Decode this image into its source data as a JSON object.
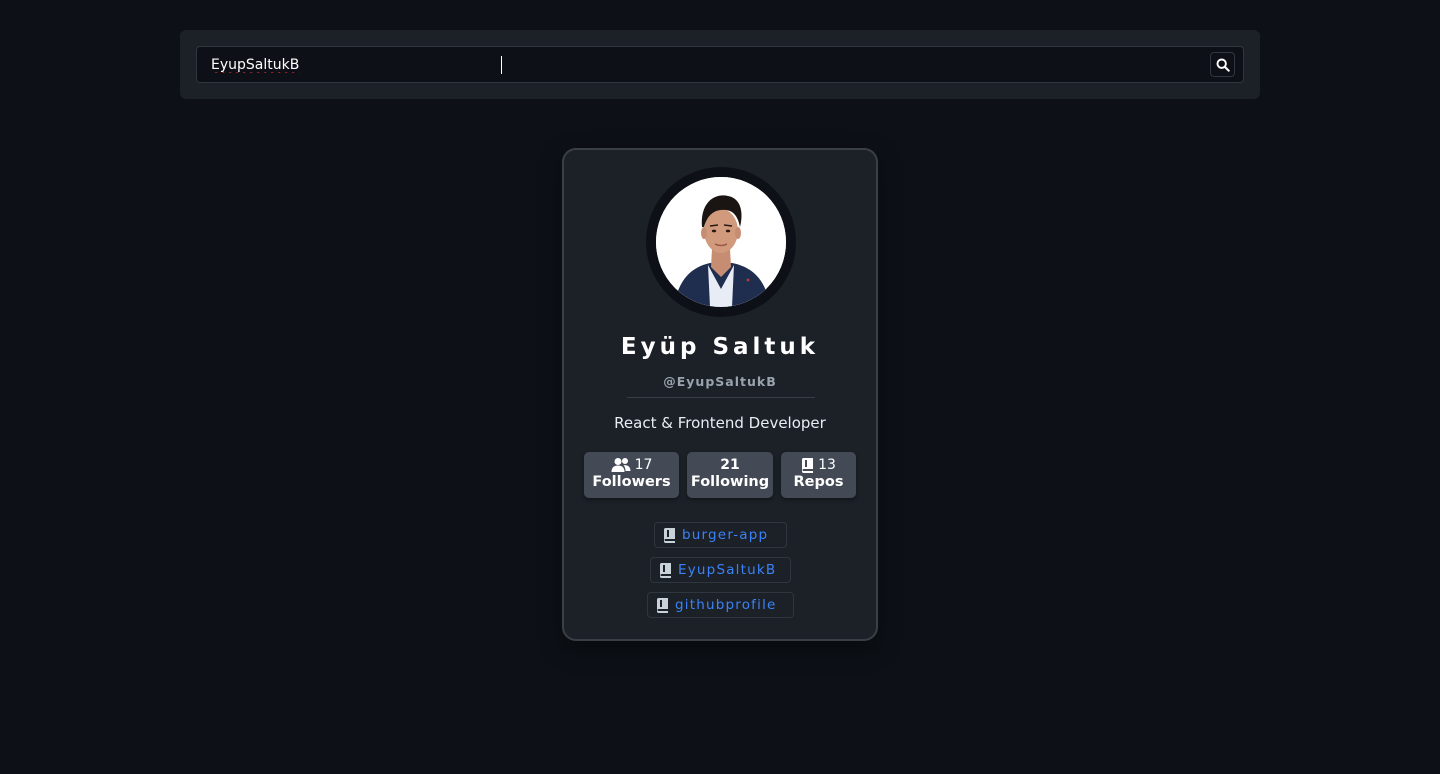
{
  "search": {
    "value": "EyupSaltukB",
    "icon": "search-icon"
  },
  "profile": {
    "name": "Eyüp Saltuk",
    "login": "@EyupSaltukB",
    "bio": "React & Frontend Developer",
    "avatar_icon": "avatar"
  },
  "stats": {
    "followers": {
      "count": "17",
      "label": "Followers",
      "icon": "users-icon"
    },
    "following": {
      "count": "21",
      "label": "Following"
    },
    "repos": {
      "count": "13",
      "label": "Repos",
      "icon": "book-icon"
    }
  },
  "repos": [
    {
      "name": "burger-app",
      "icon": "book-icon"
    },
    {
      "name": "EyupSaltukB",
      "icon": "book-icon"
    },
    {
      "name": "githubprofile",
      "icon": "book-icon"
    }
  ],
  "colors": {
    "background": "#0d1117",
    "panel": "#1c2128",
    "stat_bg": "#444a55",
    "link": "#3b82f6"
  }
}
